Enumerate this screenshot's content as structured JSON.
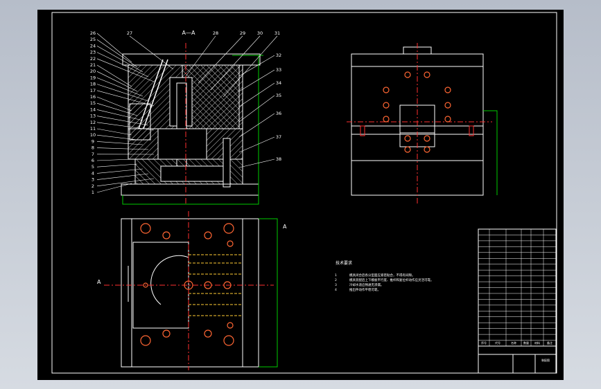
{
  "section_title": "A—A",
  "section_mark": "A",
  "part_labels_left": [
    "26",
    "25",
    "24",
    "23",
    "22",
    "21",
    "20",
    "19",
    "18",
    "17",
    "16",
    "15",
    "14",
    "13",
    "12",
    "11",
    "10",
    "9",
    "8",
    "7",
    "6",
    "5",
    "4",
    "3",
    "2",
    "1"
  ],
  "part_labels_top": [
    "27",
    "28",
    "29",
    "30",
    "31"
  ],
  "part_labels_right": [
    "32",
    "33",
    "34",
    "35",
    "36",
    "37",
    "38"
  ],
  "tech_requirements_title": "技术要求",
  "tech_requirements": [
    {
      "num": "1",
      "text": "模具闭合后各分型面应紧密贴合，不得有间隙。"
    },
    {
      "num": "2",
      "text": "模具装配后上下模板平行度、推杆和复位杆动作应灵活可靠。"
    },
    {
      "num": "3",
      "text": "冷却水道应畅通无渗漏。"
    },
    {
      "num": "4",
      "text": "推出件动作平稳可靠。"
    }
  ],
  "title_block": {
    "header": [
      "序号",
      "代号",
      "名称",
      "数量",
      "材料",
      "备注"
    ],
    "drawing_name": "装配图"
  },
  "colors": {
    "background": "#000000",
    "frame": "#ffffff",
    "outline": "#ffffff",
    "hatch": "#c8c8c8",
    "centerline": "#ff3030",
    "dimension": "#00cc00",
    "hole": "#ff6633",
    "window_bg": "#b6bdc9"
  }
}
